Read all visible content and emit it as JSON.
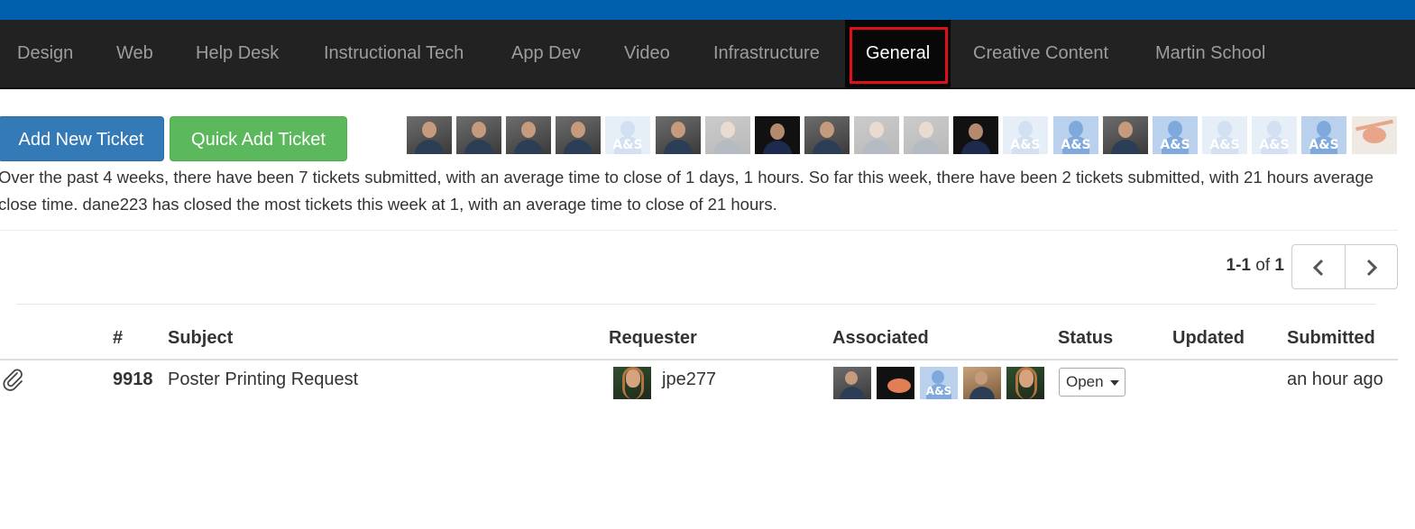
{
  "nav": {
    "items": [
      {
        "label": "Design",
        "active": false
      },
      {
        "label": "Web",
        "active": false
      },
      {
        "label": "Help Desk",
        "active": false
      },
      {
        "label": "Instructional Tech",
        "active": false
      },
      {
        "label": "App Dev",
        "active": false
      },
      {
        "label": "Video",
        "active": false
      },
      {
        "label": "Infrastructure",
        "active": false
      },
      {
        "label": "General",
        "active": true
      },
      {
        "label": "Creative Content",
        "active": false
      },
      {
        "label": "Martin School",
        "active": false
      }
    ]
  },
  "toolbar": {
    "add_new_label": "Add New Ticket",
    "quick_add_label": "Quick Add Ticket"
  },
  "team_avatars": {
    "default_avatar_text": "A&S",
    "items": [
      "photo",
      "photo",
      "photo",
      "photo",
      "default-faded",
      "photo",
      "photo-faded",
      "dark",
      "photo",
      "photo-faded",
      "photo-faded",
      "dark",
      "default-faded",
      "default",
      "photo",
      "default",
      "default-faded",
      "default-faded",
      "default",
      "crab"
    ]
  },
  "summary": {
    "text": "Over the past 4 weeks, there have been 7 tickets submitted, with an average time to close of 1 days, 1 hours. So far this week, there have been 2 tickets submitted, with 21 hours average close time. dane223 has closed the most tickets this week at 1, with an average time to close of 21 hours."
  },
  "pagination": {
    "range": "1-1",
    "of_label": "of",
    "total": "1",
    "prev_icon": "chevron-left-icon",
    "next_icon": "chevron-right-icon"
  },
  "table": {
    "headers": {
      "number": "#",
      "subject": "Subject",
      "requester": "Requester",
      "associated": "Associated",
      "status": "Status",
      "updated": "Updated",
      "submitted": "Submitted"
    },
    "rows": [
      {
        "has_attachment": true,
        "number": "9918",
        "subject": "Poster Printing Request",
        "requester": "jpe277",
        "associated": [
          "photo",
          "crab-dark",
          "default",
          "photo-blonde",
          "photo-green"
        ],
        "status": "Open",
        "updated": "",
        "submitted": "an hour ago"
      }
    ]
  },
  "colors": {
    "topbar": "#0060ae",
    "navbar": "#222222",
    "highlight": "#e0101a",
    "primary_button": "#337ab7",
    "success_button": "#5cb85c"
  }
}
